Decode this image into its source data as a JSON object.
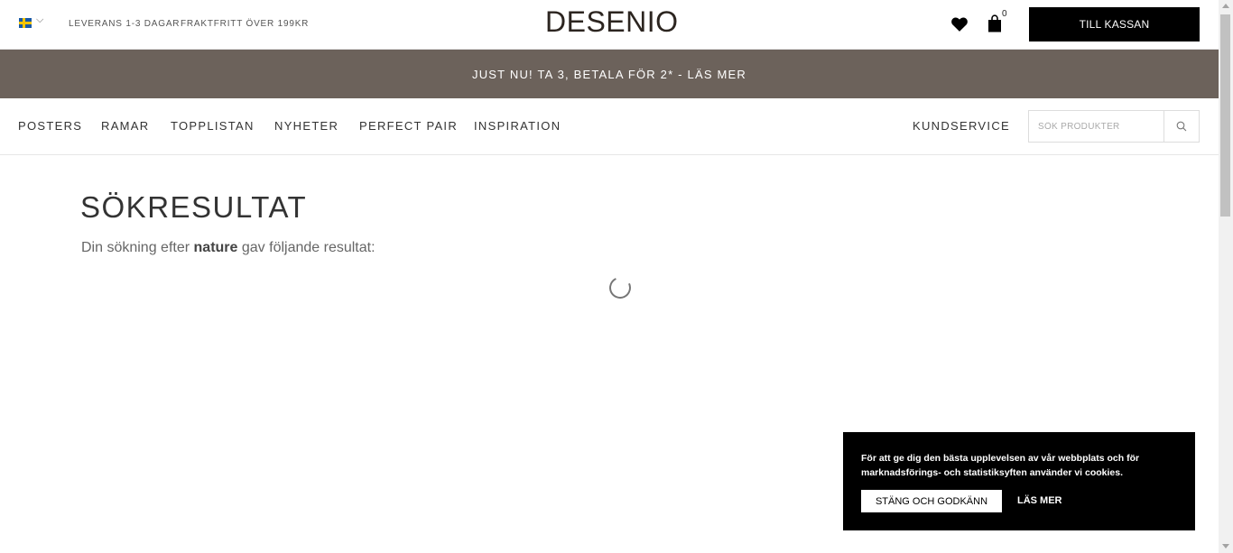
{
  "topbar": {
    "country_chevron": "⌵",
    "usp_delivery": "LEVERANS 1-3 DAGAR",
    "usp_shipping": "FRAKTFRITT ÖVER 199KR",
    "logo": "DESENIO",
    "cart_count": "0",
    "checkout_label": "TILL KASSAN"
  },
  "promo": {
    "text": "JUST NU! TA 3, BETALA FÖR 2* - LÄS MER"
  },
  "nav": {
    "items": [
      "POSTERS",
      "RAMAR",
      "TOPPLISTAN",
      "NYHETER",
      "PERFECT PAIR",
      "INSPIRATION"
    ],
    "customer_service": "KUNDSERVICE",
    "search_placeholder": "SÖK PRODUKTER"
  },
  "main": {
    "title": "SÖKRESULTAT",
    "result_prefix": "Din sökning efter",
    "query": "nature",
    "result_suffix": "gav följande resultat:"
  },
  "cookie": {
    "text": "För att ge dig den bästa upplevelsen av vår webbplats och för marknadsförings- och statistiksyften använder vi cookies.",
    "accept_label": "STÄNG OCH GODKÄNN",
    "more_label": "LÄS MER"
  },
  "colors": {
    "promo_bg": "#6c625b",
    "checkout_bg": "#000000",
    "cookie_bg": "#000000"
  }
}
